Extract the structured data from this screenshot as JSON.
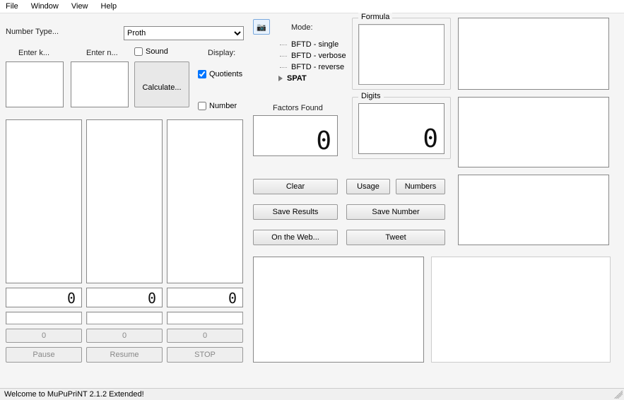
{
  "menu": {
    "file": "File",
    "window": "Window",
    "view": "View",
    "help": "Help"
  },
  "left": {
    "number_type_label": "Number Type...",
    "number_type_value": "Proth",
    "enter_k": "Enter k...",
    "enter_n": "Enter n...",
    "sound": "Sound",
    "display_title": "Display:",
    "quotients": "Quotients",
    "number": "Number",
    "calculate": "Calculate...",
    "digits": [
      "0",
      "0",
      "0"
    ],
    "counters": [
      "0",
      "0",
      "0"
    ],
    "pause": "Pause",
    "resume": "Resume",
    "stop": "STOP"
  },
  "mode": {
    "title": "Mode:",
    "items": [
      {
        "label": "BFTD - single",
        "selected": false
      },
      {
        "label": "BFTD - verbose",
        "selected": false
      },
      {
        "label": "BFTD - reverse",
        "selected": false
      },
      {
        "label": "SPAT",
        "selected": true
      }
    ]
  },
  "mid": {
    "factors_title": "Factors Found",
    "factors_value": "0",
    "clear": "Clear",
    "save_results": "Save Results",
    "on_the_web": "On the Web...",
    "usage": "Usage",
    "numbers": "Numbers",
    "save_number": "Save Number",
    "tweet": "Tweet"
  },
  "right": {
    "formula": "Formula",
    "digits": "Digits",
    "digits_value": "0"
  },
  "status": "Welcome to MuPuPriNT 2.1.2 Extended!"
}
